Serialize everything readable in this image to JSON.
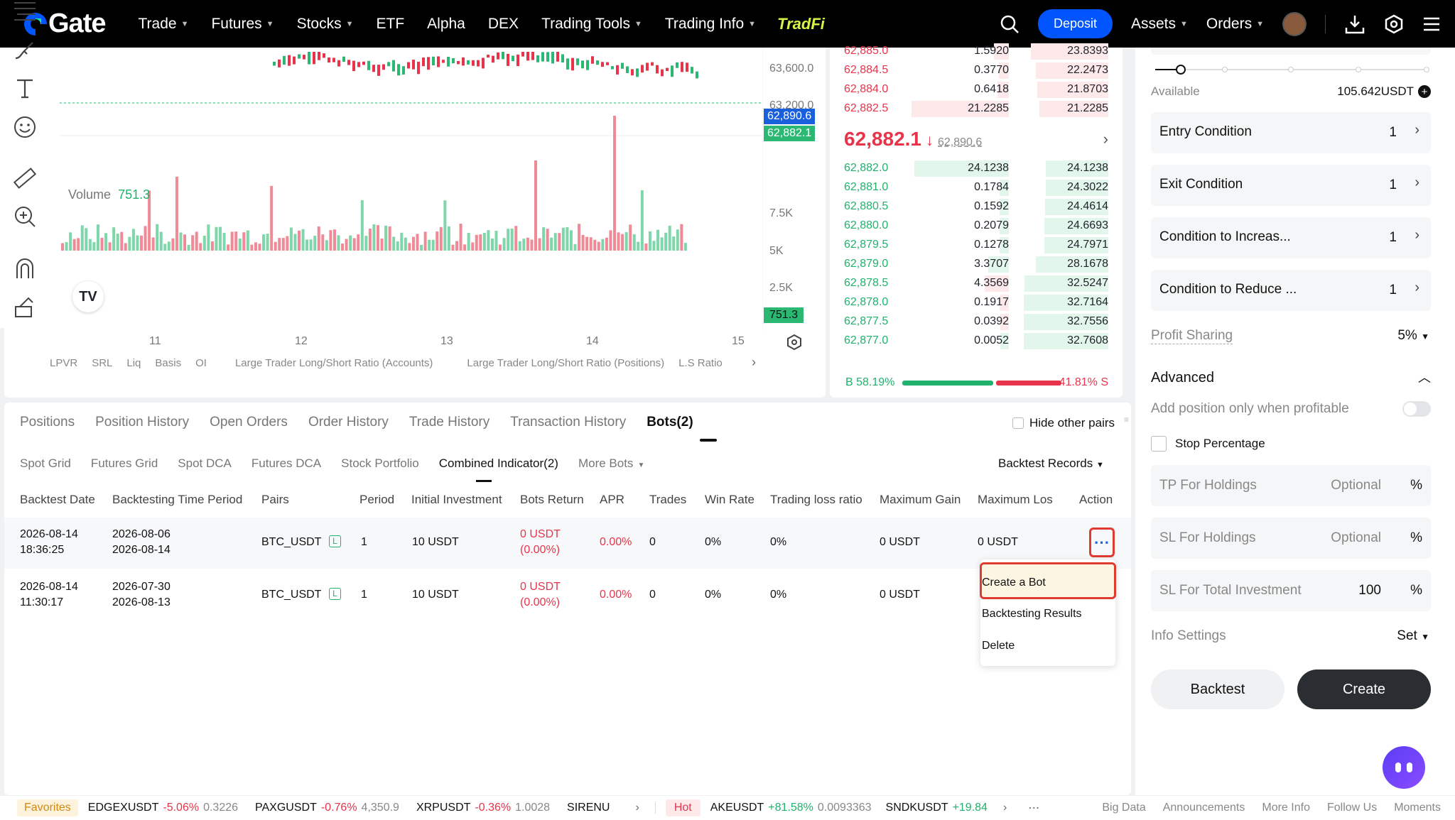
{
  "nav": {
    "logo": "Gate",
    "items": [
      "Trade",
      "Futures",
      "Stocks",
      "ETF",
      "Alpha",
      "DEX",
      "Trading Tools",
      "Trading Info"
    ],
    "has_caret": [
      true,
      true,
      true,
      false,
      false,
      false,
      true,
      true
    ],
    "tradfi": "TradFi",
    "deposit": "Deposit",
    "assets": "Assets",
    "orders": "Orders"
  },
  "chart": {
    "price_labels": [
      "63,600.0",
      "63,200.0"
    ],
    "last_price_tag": "62,890.6",
    "mark_price_tag": "62,882.1",
    "volume_label": "Volume",
    "volume_value": "751.3",
    "volume_ticks": [
      "7.5K",
      "5K",
      "2.5K"
    ],
    "volume_tag": "751.3",
    "x_ticks": [
      "11",
      "12",
      "13",
      "14",
      "15"
    ],
    "indicator_tabs": [
      "LPVR",
      "SRL",
      "Liq",
      "Basis",
      "OI",
      "Large Trader Long/Short Ratio (Accounts)",
      "Large Trader Long/Short Ratio (Positions)",
      "L.S Ratio"
    ]
  },
  "orderbook": {
    "asks": [
      {
        "price": "62,885.0",
        "amount": "1.5920",
        "total": "23.8393"
      },
      {
        "price": "62,884.5",
        "amount": "0.3770",
        "total": "22.2473"
      },
      {
        "price": "62,884.0",
        "amount": "0.6418",
        "total": "21.8703"
      },
      {
        "price": "62,882.5",
        "amount": "21.2285",
        "total": "21.2285"
      }
    ],
    "mid_price": "62,882.1",
    "mid_mark": "62,890.6",
    "bids": [
      {
        "price": "62,882.0",
        "amount": "24.1238",
        "total": "24.1238"
      },
      {
        "price": "62,881.0",
        "amount": "0.1784",
        "total": "24.3022"
      },
      {
        "price": "62,880.5",
        "amount": "0.1592",
        "total": "24.4614"
      },
      {
        "price": "62,880.0",
        "amount": "0.2079",
        "total": "24.6693"
      },
      {
        "price": "62,879.5",
        "amount": "0.1278",
        "total": "24.7971"
      },
      {
        "price": "62,879.0",
        "amount": "3.3707",
        "total": "28.1678"
      },
      {
        "price": "62,878.5",
        "amount": "4.3569",
        "total": "32.5247"
      },
      {
        "price": "62,878.0",
        "amount": "0.1917",
        "total": "32.7164"
      },
      {
        "price": "62,877.5",
        "amount": "0.0392",
        "total": "32.7556"
      },
      {
        "price": "62,877.0",
        "amount": "0.0052",
        "total": "32.7608"
      }
    ],
    "buy_ratio": "B 58.19%",
    "sell_ratio": "41.81% S",
    "buy_fraction": 0.5819
  },
  "bottom": {
    "tabs": [
      "Positions",
      "Position History",
      "Open Orders",
      "Order History",
      "Trade History",
      "Transaction History",
      "Bots(2)"
    ],
    "hide_other_pairs": "Hide other pairs",
    "bot_tabs": [
      "Spot Grid",
      "Futures Grid",
      "Spot DCA",
      "Futures DCA",
      "Stock Portfolio",
      "Combined Indicator(2)",
      "More Bots"
    ],
    "backtest_records": "Backtest Records",
    "headers": [
      "Backtest Date",
      "Backtesting Time Period",
      "Pairs",
      "Period",
      "Initial Investment",
      "Bots Return",
      "APR",
      "Trades",
      "Win Rate",
      "Trading loss ratio",
      "Maximum Gain",
      "Maximum Los",
      "Action"
    ],
    "rows": [
      {
        "date": "2026-08-14",
        "time": "18:36:25",
        "p_start": "2026-08-06",
        "p_end": "2026-08-14",
        "pair": "BTC_USDT",
        "badge": "L",
        "period": "1",
        "invest": "10 USDT",
        "ret": "0 USDT",
        "ret_pct": "(0.00%)",
        "apr": "0.00%",
        "trades": "0",
        "win": "0%",
        "loss": "0%",
        "gain": "0 USDT",
        "maxloss": "0 USDT"
      },
      {
        "date": "2026-08-14",
        "time": "11:30:17",
        "p_start": "2026-07-30",
        "p_end": "2026-08-13",
        "pair": "BTC_USDT",
        "badge": "L",
        "period": "1",
        "invest": "10 USDT",
        "ret": "0 USDT",
        "ret_pct": "(0.00%)",
        "apr": "0.00%",
        "trades": "0",
        "win": "0%",
        "loss": "0%",
        "gain": "0 USDT",
        "maxloss": ""
      }
    ],
    "menu": [
      "Create a Bot",
      "Backtesting Results",
      "Delete"
    ]
  },
  "form": {
    "available_label": "Available",
    "available_value": "105.642USDT",
    "conditions": [
      {
        "label": "Entry Condition",
        "value": "1"
      },
      {
        "label": "Exit Condition",
        "value": "1"
      },
      {
        "label": "Condition to Increas...",
        "value": "1"
      },
      {
        "label": "Condition to Reduce ...",
        "value": "1"
      }
    ],
    "profit_sharing_label": "Profit Sharing",
    "profit_sharing_value": "5%",
    "advanced": "Advanced",
    "add_position": "Add position only when profitable",
    "stop_percentage": "Stop Percentage",
    "fields": [
      {
        "label": "TP For Holdings",
        "value": "Optional",
        "unit": "%"
      },
      {
        "label": "SL For Holdings",
        "value": "Optional",
        "unit": "%"
      },
      {
        "label": "SL For Total Investment",
        "value": "100",
        "unit": "%"
      }
    ],
    "info_settings": "Info Settings",
    "info_value": "Set",
    "backtest": "Backtest",
    "create": "Create"
  },
  "ticker": {
    "favorites": "Favorites",
    "items": [
      {
        "sym": "EDGEXUSDT",
        "chg": "-5.06%",
        "price": "0.3226",
        "up": false
      },
      {
        "sym": "PAXGUSDT",
        "chg": "-0.76%",
        "price": "4,350.9",
        "up": false
      },
      {
        "sym": "XRPUSDT",
        "chg": "-0.36%",
        "price": "1.0028",
        "up": false
      },
      {
        "sym": "SIRENU",
        "chg": "",
        "price": "",
        "up": false
      }
    ],
    "hot": "Hot",
    "hot_items": [
      {
        "sym": "AKEUSDT",
        "chg": "+81.58%",
        "price": "0.0093363",
        "up": true
      },
      {
        "sym": "SNDKUSDT",
        "chg": "+19.84",
        "price": "",
        "up": true
      }
    ],
    "links": [
      "Big Data",
      "Announcements",
      "More Info",
      "Follow Us",
      "Moments"
    ]
  }
}
